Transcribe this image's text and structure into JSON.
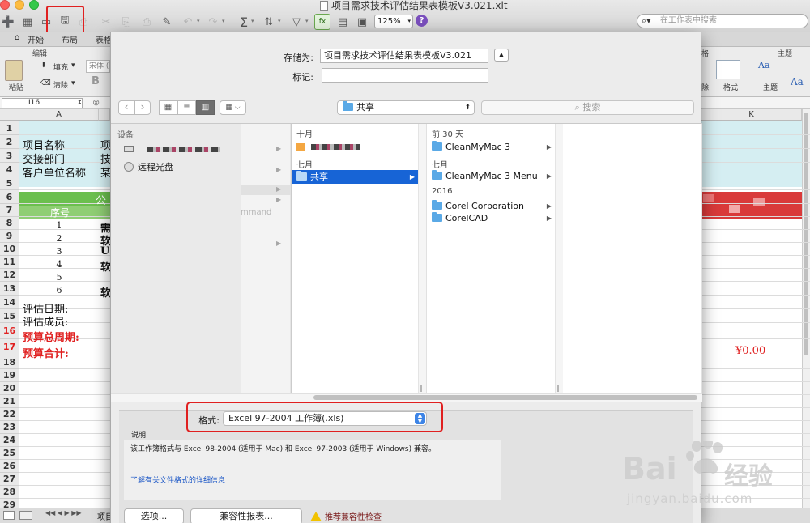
{
  "window": {
    "title": "项目需求技术评估结果表模板V3.021.xlt"
  },
  "toolbar": {
    "zoom": "125%",
    "help": "?",
    "search_placeholder": "在工作表中搜索"
  },
  "ribbon": {
    "tabs": [
      "开始",
      "布局",
      "表格"
    ],
    "home_group": "编辑",
    "paste_label": "粘贴",
    "fill_label": "填充",
    "clear_label": "清除",
    "font_name": "宋体 (",
    "bold": "B",
    "right_group_cells": "格",
    "right_group_theme": "主题",
    "format_label": "格式",
    "theme_label": "主题",
    "delete_label": "除"
  },
  "formula_bar": {
    "cell_ref": "I16"
  },
  "sheet": {
    "columns": [
      "A",
      "K"
    ],
    "rows": [
      "1",
      "2",
      "3",
      "4",
      "5",
      "6",
      "7",
      "8",
      "9",
      "10",
      "11",
      "12",
      "13",
      "14",
      "15",
      "16",
      "17",
      "18",
      "19",
      "20",
      "21",
      "22",
      "23",
      "24",
      "25",
      "26",
      "27",
      "28",
      "29"
    ],
    "red_rows": [
      "16",
      "17"
    ],
    "labels": {
      "r2": "项目名称",
      "r2b": "项",
      "r3": "交接部门",
      "r3b": "技",
      "r4": "客户单位名称",
      "r4b": "某",
      "r6": "公",
      "r7": "序号",
      "r14": "评估日期:",
      "r15": "评估成员:",
      "r16": "预算总周期:",
      "r17": "预算合计:"
    },
    "seq": [
      "1",
      "2",
      "3",
      "4",
      "5",
      "6"
    ],
    "seq_b": [
      "需",
      "软",
      "UI",
      "软",
      "",
      "软"
    ],
    "total": "¥0.00",
    "sheet_tab": "项目"
  },
  "dialog": {
    "save_as_label": "存储为:",
    "save_as_value": "项目需求技术评估结果表模板V3.021",
    "tags_label": "标记:",
    "tags_value": "",
    "location": "共享",
    "search_placeholder": "搜索",
    "sidebar_head": "设备",
    "sidebar_remote": "远程光盘",
    "col1_partial": "mmand",
    "col2": {
      "head1": "十月",
      "head2": "七月",
      "selected": "共享"
    },
    "col3": {
      "head1": "前 30 天",
      "item1": "CleanMyMac 3",
      "head2": "七月",
      "item2": "CleanMyMac 3 Menu",
      "head3": "2016",
      "item3": "Corel Corporation",
      "item4": "CorelCAD"
    },
    "format_label": "格式:",
    "format_value": "Excel 97-2004 工作簿(.xls)",
    "description_label": "说明",
    "description_text": "该工作簿格式与 Excel 98-2004 (适用于 Mac) 和 Excel 97-2003 (适用于 Windows) 兼容。",
    "more_info_link": "了解有关文件格式的详细信息",
    "options_button": "选项...",
    "compat_button": "兼容性报表...",
    "compat_warning": "推荐兼容性检查"
  },
  "watermark": {
    "brand": "Bai",
    "brand_cn": "经验",
    "url": "jingyan.baidu.com"
  },
  "colors": {
    "highlight": "#e02020",
    "selection": "#1764d6",
    "header_fill": "#d5eef2",
    "green_row": "#6bbf4e",
    "red_text": "#e02020"
  }
}
